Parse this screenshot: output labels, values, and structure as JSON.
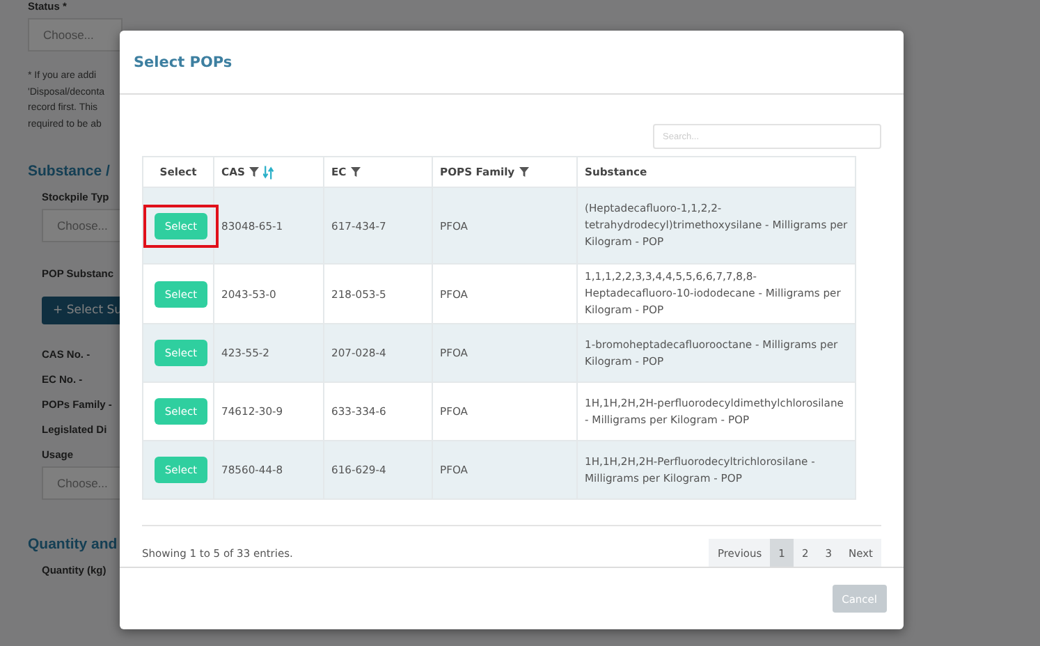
{
  "background_form": {
    "status_label": "Status *",
    "status_select": "Choose...",
    "note_lines": [
      "* If you are addi",
      "'Disposal/deconta",
      "record first. This",
      "required to be ab"
    ],
    "section_title": "Substance /",
    "stockpile_label": "Stockpile Typ",
    "stockpile_select": "Choose...",
    "pop_label": "POP Substanc",
    "select_button": "+ Select Su",
    "info_lines": [
      "CAS No. -",
      "EC No. -",
      "POPs Family -",
      "Legislated Di"
    ],
    "usage_label": "Usage",
    "usage_select": "Choose...",
    "section2_title": "Quantity and",
    "quantity_label": "Quantity (kg)"
  },
  "modal": {
    "title": "Select POPs",
    "search": {
      "placeholder": "Search..."
    },
    "columns": [
      {
        "label": "Select",
        "filter": false,
        "sort": false
      },
      {
        "label": "CAS",
        "filter": true,
        "sort": true
      },
      {
        "label": "EC",
        "filter": true,
        "sort": false
      },
      {
        "label": "POPS Family",
        "filter": true,
        "sort": false
      },
      {
        "label": "Substance",
        "filter": false,
        "sort": false
      }
    ],
    "rows": [
      {
        "button": "Select",
        "cas": "83048-65-1",
        "ec": "617-434-7",
        "family": "PFOA",
        "substance": "(Heptadecafluoro-1,1,2,2-tetrahydrodecyl)trimethoxysilane - Milligrams per Kilogram - POP",
        "highlighted": true
      },
      {
        "button": "Select",
        "cas": "2043-53-0",
        "ec": "218-053-5",
        "family": "PFOA",
        "substance": "1,1,1,2,2,3,3,4,4,5,5,6,6,7,7,8,8-Heptadecafluoro-10-iododecane - Milligrams per Kilogram - POP",
        "highlighted": false
      },
      {
        "button": "Select",
        "cas": "423-55-2",
        "ec": "207-028-4",
        "family": "PFOA",
        "substance": "1-bromoheptadecafluorooctane - Milligrams per Kilogram - POP",
        "highlighted": false
      },
      {
        "button": "Select",
        "cas": "74612-30-9",
        "ec": "633-334-6",
        "family": "PFOA",
        "substance": "1H,1H,2H,2H-perfluorodecyldimethylchlorosilane - Milligrams per Kilogram - POP",
        "highlighted": false
      },
      {
        "button": "Select",
        "cas": "78560-44-8",
        "ec": "616-629-4",
        "family": "PFOA",
        "substance": "1H,1H,2H,2H-Perfluorodecyltrichlorosilane - Milligrams per Kilogram - POP",
        "highlighted": false
      }
    ],
    "info": "Showing 1 to 5 of 33 entries.",
    "pagination": [
      {
        "label": "Previous",
        "selected": false
      },
      {
        "label": "1",
        "selected": true
      },
      {
        "label": "2",
        "selected": false
      },
      {
        "label": "3",
        "selected": false
      },
      {
        "label": "Next",
        "selected": false
      }
    ],
    "cancel": {
      "label": "Cancel",
      "disabled": true
    }
  }
}
